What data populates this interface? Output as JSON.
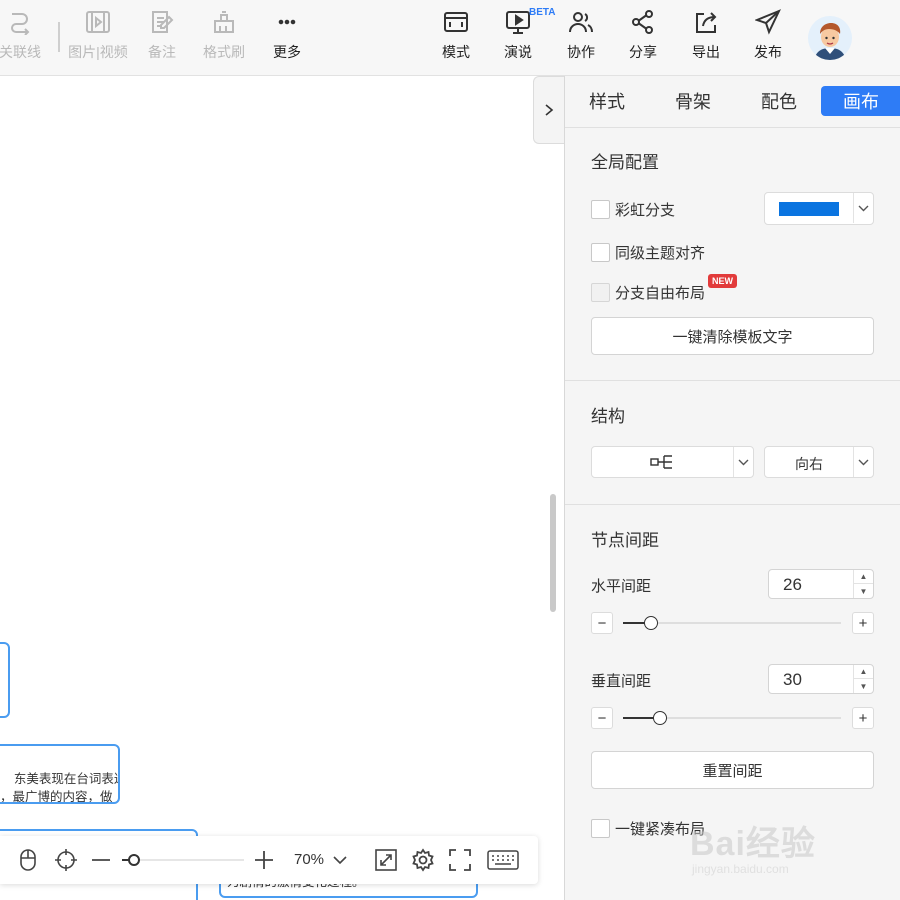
{
  "toolbar": {
    "items": [
      {
        "label": "关联线",
        "icon": "relation-line-icon",
        "enabled": false
      },
      {
        "label": "图片|视频",
        "icon": "image-video-icon",
        "enabled": false
      },
      {
        "label": "备注",
        "icon": "note-icon",
        "enabled": false
      },
      {
        "label": "格式刷",
        "icon": "format-brush-icon",
        "enabled": false
      },
      {
        "label": "更多",
        "icon": "more-icon",
        "enabled": true
      },
      {
        "label": "模式",
        "icon": "mode-icon",
        "enabled": true
      },
      {
        "label": "演说",
        "icon": "presentation-icon",
        "enabled": true
      },
      {
        "label": "协作",
        "icon": "collaborate-icon",
        "enabled": true
      },
      {
        "label": "分享",
        "icon": "share-icon",
        "enabled": true
      },
      {
        "label": "导出",
        "icon": "export-icon",
        "enabled": true
      },
      {
        "label": "发布",
        "icon": "publish-icon",
        "enabled": true
      }
    ],
    "beta_badge": "BETA"
  },
  "canvas": {
    "nodes": [
      {
        "text": ""
      },
      {
        "text": "东美表现在台词表达\n，最广博的内容，做"
      },
      {
        "text": ""
      },
      {
        "text": "为剧情的激情变化过程。"
      }
    ]
  },
  "bottom_bar": {
    "zoom_label": "70%",
    "zoom_level": 0.1
  },
  "panel": {
    "tabs": [
      "样式",
      "骨架",
      "配色",
      "画布"
    ],
    "active_tab": "画布",
    "global": {
      "title": "全局配置",
      "rainbow_label": "彩虹分支",
      "rainbow_checked": false,
      "branch_color": "#0a74e0",
      "align_label": "同级主题对齐",
      "align_checked": false,
      "free_layout_label": "分支自由布局",
      "free_layout_checked": false,
      "new_badge": "NEW",
      "clear_button": "一键清除模板文字"
    },
    "structure": {
      "title": "结构",
      "layout_icon": "mindmap-right-structure-icon",
      "direction": "向右"
    },
    "spacing": {
      "title": "节点间距",
      "horizontal_label": "水平间距",
      "horizontal_value": "26",
      "horizontal_level": 0.13,
      "vertical_label": "垂直间距",
      "vertical_value": "30",
      "vertical_level": 0.17,
      "reset_button": "重置间距",
      "compact_label": "一键紧凑布局",
      "compact_checked": false
    }
  },
  "watermark": {
    "text": "Bai经验",
    "sub": "jingyan.baidu.com"
  }
}
